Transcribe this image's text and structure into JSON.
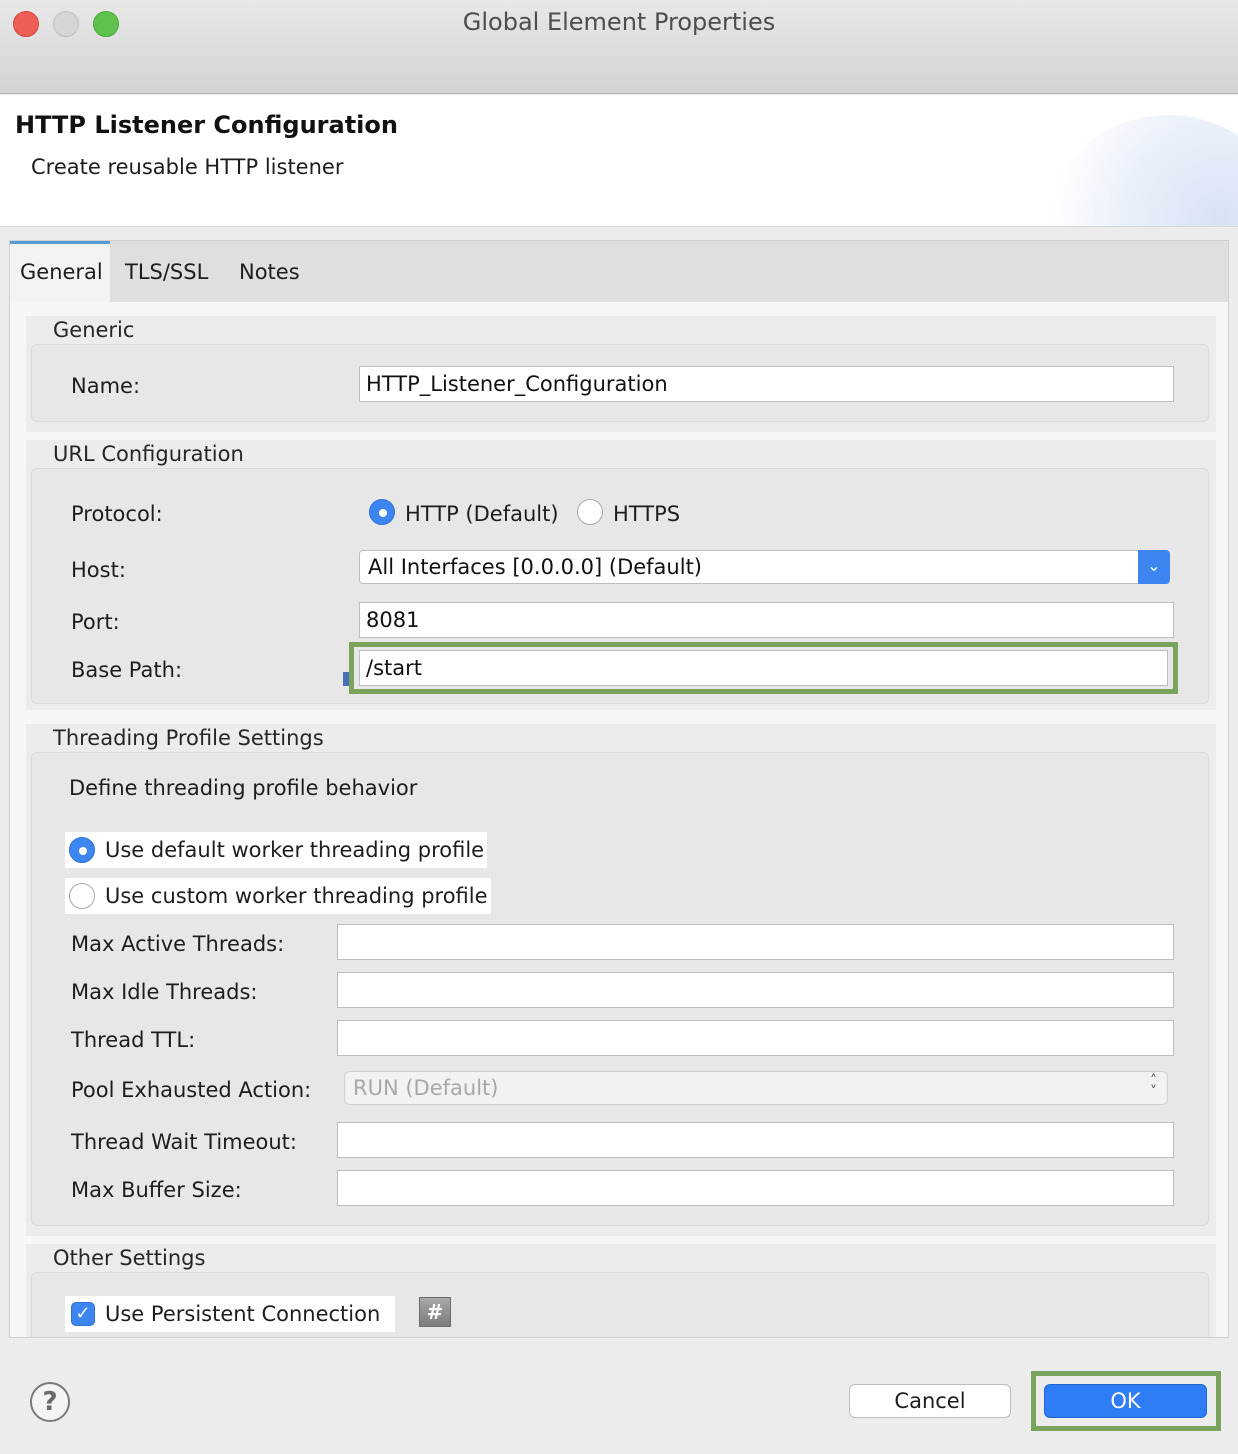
{
  "window": {
    "title": "Global Element Properties"
  },
  "header": {
    "title": "HTTP Listener Configuration",
    "subtitle": "Create reusable HTTP listener"
  },
  "tabs": [
    {
      "label": "General",
      "active": true
    },
    {
      "label": "TLS/SSL",
      "active": false
    },
    {
      "label": "Notes",
      "active": false
    }
  ],
  "generic": {
    "title": "Generic",
    "name_label": "Name:",
    "name_value": "HTTP_Listener_Configuration"
  },
  "url": {
    "title": "URL Configuration",
    "protocol_label": "Protocol:",
    "protocol_options": [
      {
        "label": "HTTP (Default)",
        "selected": true
      },
      {
        "label": "HTTPS",
        "selected": false
      }
    ],
    "host_label": "Host:",
    "host_value": "All Interfaces [0.0.0.0] (Default)",
    "port_label": "Port:",
    "port_value": "8081",
    "base_path_label": "Base Path:",
    "base_path_value": "/start"
  },
  "threading": {
    "title": "Threading Profile Settings",
    "description": "Define threading profile behavior",
    "options": [
      {
        "label": "Use default worker threading profile",
        "selected": true
      },
      {
        "label": "Use custom worker threading profile",
        "selected": false
      }
    ],
    "fields": [
      {
        "label": "Max Active Threads:",
        "value": ""
      },
      {
        "label": "Max Idle Threads:",
        "value": ""
      },
      {
        "label": "Thread TTL:",
        "value": ""
      },
      {
        "label": "Pool Exhausted Action:",
        "value": "RUN (Default)"
      },
      {
        "label": "Thread Wait Timeout:",
        "value": ""
      },
      {
        "label": "Max Buffer Size:",
        "value": ""
      }
    ]
  },
  "other": {
    "title": "Other Settings",
    "persistent_label": "Use Persistent Connection",
    "persistent_checked": true,
    "hash_symbol": "#"
  },
  "footer": {
    "help_symbol": "?",
    "cancel_label": "Cancel",
    "ok_label": "OK"
  },
  "colors": {
    "accent": "#3d86f2",
    "highlight": "#7aa35b",
    "ok_button": "#2f7df6"
  },
  "icons": [
    "close-dot",
    "minimize-dot",
    "zoom-dot",
    "chevron-down-icon",
    "updown-arrows-icon",
    "checkmark-icon",
    "hash-icon",
    "help-icon"
  ]
}
